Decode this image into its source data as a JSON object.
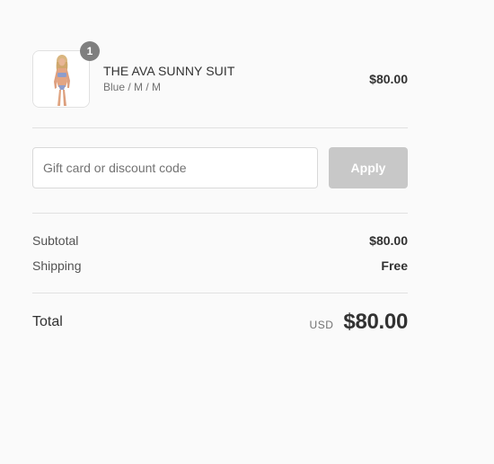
{
  "cart": {
    "item": {
      "quantity": "1",
      "name": "THE AVA SUNNY SUIT",
      "variant": "Blue / M / M",
      "price": "$80.00",
      "image_icon": "product-thumbnail"
    }
  },
  "discount": {
    "placeholder": "Gift card or discount code",
    "value": "",
    "apply_label": "Apply"
  },
  "totals": {
    "subtotal_label": "Subtotal",
    "subtotal_value": "$80.00",
    "shipping_label": "Shipping",
    "shipping_value": "Free",
    "total_label": "Total",
    "currency": "USD",
    "total_value": "$80.00"
  },
  "colors": {
    "background": "#fafafa",
    "badge": "#7f7f7f",
    "apply_disabled": "#c8c8c8",
    "divider": "#e1e1e1",
    "text_primary": "#323232",
    "text_secondary": "#717171"
  }
}
